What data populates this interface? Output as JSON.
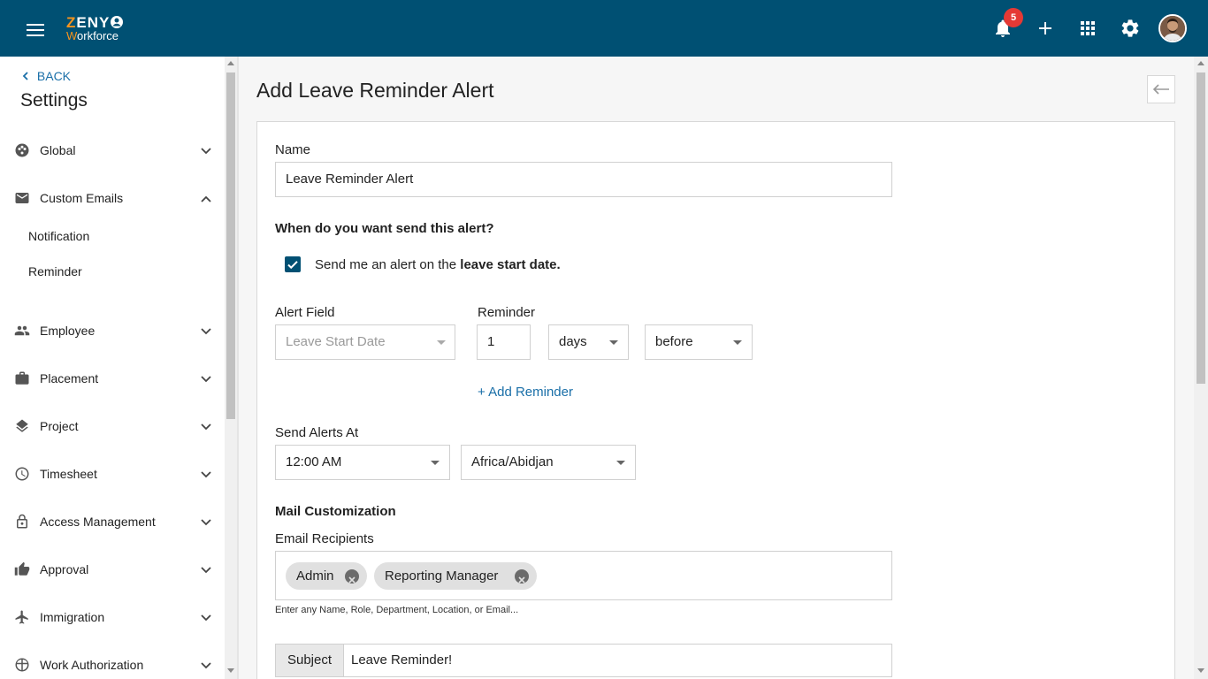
{
  "app": {
    "logo_line1_accent": "Z",
    "logo_line1_rest": "ENY",
    "logo_line2_accent": "W",
    "logo_line2_rest": "orkforce",
    "notification_count": "5",
    "brand_color": "#005073",
    "accent_color": "#f7941d"
  },
  "sidebar": {
    "back_label": "BACK",
    "title": "Settings",
    "items": [
      {
        "label": "Global",
        "icon": "globe-icon",
        "expanded": false
      },
      {
        "label": "Custom Emails",
        "icon": "mail-icon",
        "expanded": true
      },
      {
        "label": "Employee",
        "icon": "people-icon",
        "expanded": false
      },
      {
        "label": "Placement",
        "icon": "briefcase-icon",
        "expanded": false
      },
      {
        "label": "Project",
        "icon": "layers-icon",
        "expanded": false
      },
      {
        "label": "Timesheet",
        "icon": "clock-icon",
        "expanded": false
      },
      {
        "label": "Access Management",
        "icon": "lock-icon",
        "expanded": false
      },
      {
        "label": "Approval",
        "icon": "thumbs-up-icon",
        "expanded": false
      },
      {
        "label": "Immigration",
        "icon": "airplane-icon",
        "expanded": false
      },
      {
        "label": "Work Authorization",
        "icon": "globe-icon",
        "expanded": false
      }
    ],
    "sub_items": [
      "Notification",
      "Reminder"
    ]
  },
  "main": {
    "title": "Add Leave Reminder Alert",
    "name_label": "Name",
    "name_value": "Leave Reminder Alert",
    "when_heading": "When do you want send this alert?",
    "checkbox_text_prefix": "Send me an alert on the",
    "checkbox_text_bold": "leave start date.",
    "alert_field_label": "Alert Field",
    "alert_field_value": "Leave Start Date",
    "reminder_label": "Reminder",
    "reminder_number": "1",
    "reminder_unit": "days",
    "reminder_relation": "before",
    "add_reminder": "+ Add Reminder",
    "send_alerts_label": "Send Alerts At",
    "send_time": "12:00 AM",
    "timezone": "Africa/Abidjan",
    "mail_heading": "Mail Customization",
    "recipients_label": "Email Recipients",
    "recipients": [
      "Admin",
      "Reporting Manager"
    ],
    "recipients_hint": "Enter any Name, Role, Department, Location, or Email...",
    "subject_label": "Subject",
    "subject_value": "Leave Reminder!"
  }
}
